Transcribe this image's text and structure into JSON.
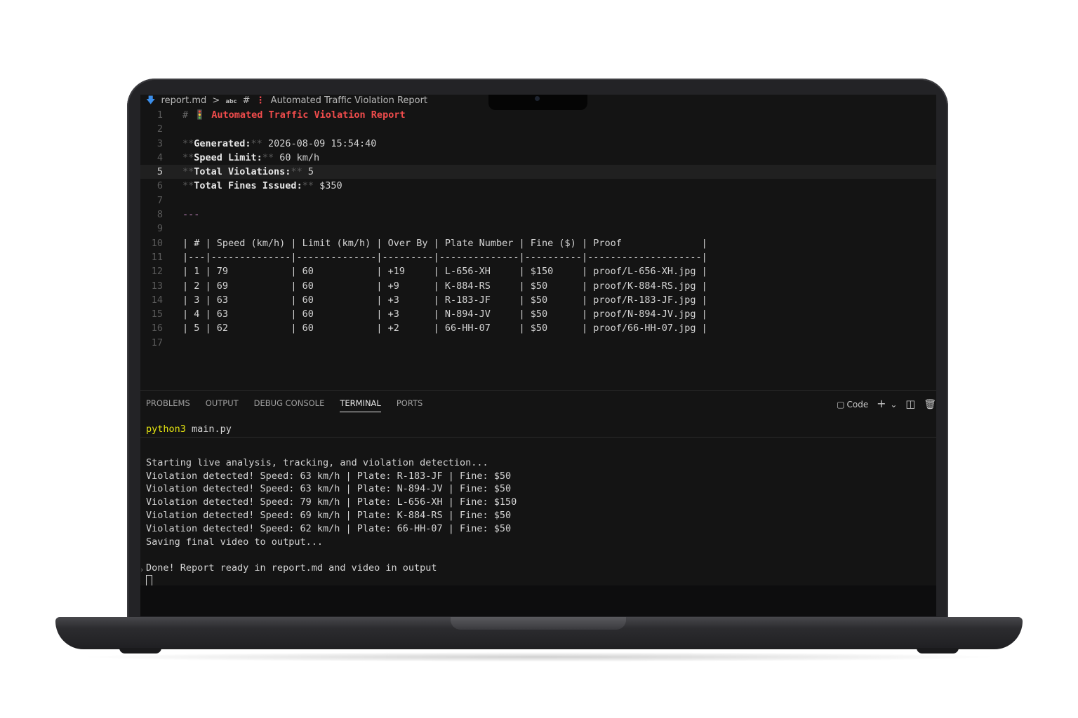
{
  "breadcrumb": {
    "file": "report.md",
    "sep": ">",
    "abc": "abc",
    "hash": "#",
    "emoji": "🚦",
    "heading": "Automated Traffic Violation Report"
  },
  "editor": {
    "active_line": "5",
    "lines": [
      {
        "n": "1",
        "hash": "#",
        "emoji": "🚦",
        "title": "Automated Traffic Violation Report"
      },
      {
        "n": "2"
      },
      {
        "n": "3",
        "pre": "**",
        "key": "Generated:",
        "post": "**",
        "val": " 2026-08-09 15:54:40"
      },
      {
        "n": "4",
        "pre": "**",
        "key": "Speed Limit:",
        "post": "**",
        "val": " 60 km/h"
      },
      {
        "n": "5",
        "pre": "**",
        "key": "Total Violations:",
        "post": "**",
        "val": " 5"
      },
      {
        "n": "6",
        "pre": "**",
        "key": "Total Fines Issued:",
        "post": "**",
        "val": " $350"
      },
      {
        "n": "7"
      },
      {
        "n": "8",
        "hr": "---"
      },
      {
        "n": "9"
      },
      {
        "n": "10",
        "text": "| # | Speed (km/h) | Limit (km/h) | Over By | Plate Number | Fine ($) | Proof              |"
      },
      {
        "n": "11",
        "text": "|---|--------------|--------------|---------|--------------|----------|--------------------|"
      },
      {
        "n": "12",
        "text": "| 1 | 79           | 60           | +19     | L-656-XH     | $150     | proof/L-656-XH.jpg |"
      },
      {
        "n": "13",
        "text": "| 2 | 69           | 60           | +9      | K-884-RS     | $50      | proof/K-884-RS.jpg |"
      },
      {
        "n": "14",
        "text": "| 3 | 63           | 60           | +3      | R-183-JF     | $50      | proof/R-183-JF.jpg |"
      },
      {
        "n": "15",
        "text": "| 4 | 63           | 60           | +3      | N-894-JV     | $50      | proof/N-894-JV.jpg |"
      },
      {
        "n": "16",
        "text": "| 5 | 62           | 60           | +2      | 66-HH-07     | $50      | proof/66-HH-07.jpg |"
      },
      {
        "n": "17"
      }
    ]
  },
  "panel": {
    "tabs": [
      "PROBLEMS",
      "OUTPUT",
      "DEBUG CONSOLE",
      "TERMINAL",
      "PORTS"
    ],
    "active_tab": "TERMINAL",
    "terminal_profile": "Code",
    "add_icon": "+",
    "dropdown_icon": "⌄"
  },
  "terminal": {
    "command_prog": "python3",
    "command_args": " main.py",
    "output": [
      "",
      "Starting live analysis, tracking, and violation detection...",
      "Violation detected! Speed: 63 km/h | Plate: R-183-JF | Fine: $50",
      "Violation detected! Speed: 63 km/h | Plate: N-894-JV | Fine: $50",
      "Violation detected! Speed: 79 km/h | Plate: L-656-XH | Fine: $150",
      "Violation detected! Speed: 69 km/h | Plate: K-884-RS | Fine: $50",
      "Violation detected! Speed: 62 km/h | Plate: 66-HH-07 | Fine: $50",
      "Saving final video to output...",
      "",
      "Done! Report ready in report.md and video in output"
    ]
  },
  "colors": {
    "heading": "#f14c4c",
    "python_prog": "#e5e510",
    "hr": "#c586c0",
    "background": "#141414"
  }
}
